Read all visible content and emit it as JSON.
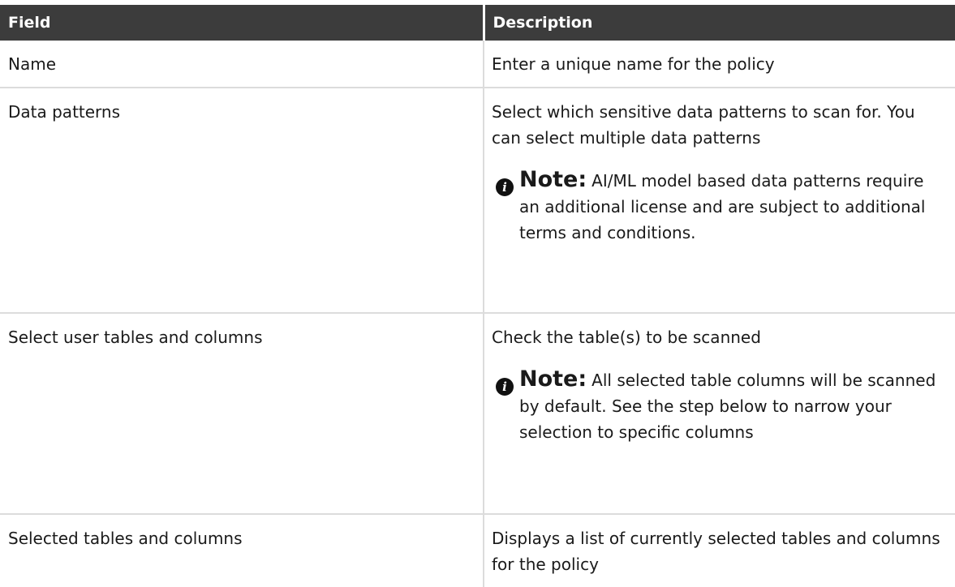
{
  "table": {
    "headers": [
      "Field",
      "Description"
    ],
    "rows": [
      {
        "field": "Name",
        "description": "Enter a unique name for the policy"
      },
      {
        "field": "Data patterns",
        "description": "Select which sensitive data patterns to scan for. You can select multiple data patterns",
        "note_label": "Note:",
        "note_text": "AI/ML model based data patterns require an additional license and are subject to additional terms and conditions."
      },
      {
        "field": "Select user tables and columns",
        "description": "Check the table(s) to be scanned",
        "note_label": "Note:",
        "note_text": "All selected table columns will be scanned by default. See the step below to narrow your selection to specific columns"
      },
      {
        "field": "Selected tables and columns",
        "description": "Displays a list of currently selected tables and columns for the policy"
      }
    ]
  },
  "icons": {
    "note_icon": "info-icon",
    "note_glyph": "i"
  }
}
